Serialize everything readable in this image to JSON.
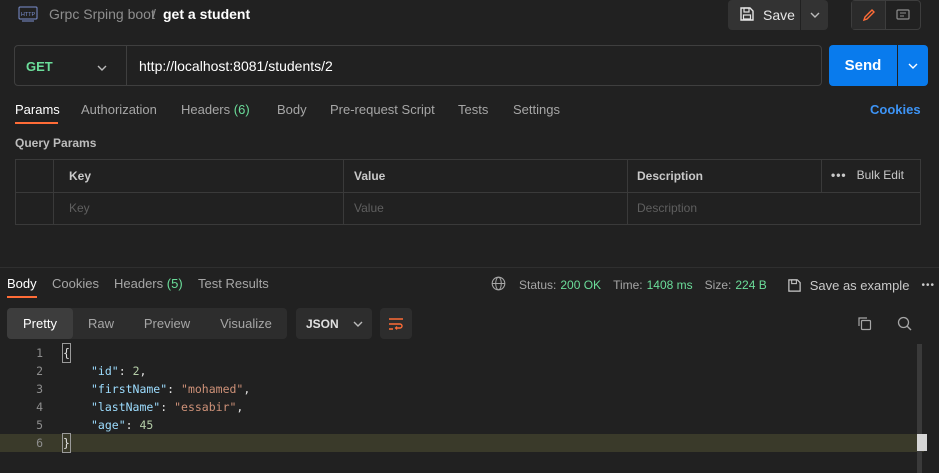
{
  "breadcrumb": {
    "parent": "Grpc Srping boot",
    "separator": "/",
    "current": "get a student"
  },
  "toolbar": {
    "save_label": "Save"
  },
  "request": {
    "method": "GET",
    "url": "http://localhost:8081/students/2",
    "send_label": "Send"
  },
  "request_tabs": [
    {
      "label": "Params"
    },
    {
      "label": "Authorization"
    },
    {
      "label": "Headers",
      "count": "(6)"
    },
    {
      "label": "Body"
    },
    {
      "label": "Pre-request Script"
    },
    {
      "label": "Tests"
    },
    {
      "label": "Settings"
    }
  ],
  "cookies_link": "Cookies",
  "query_params": {
    "title": "Query Params",
    "columns": [
      "Key",
      "Value",
      "Description"
    ],
    "placeholders": [
      "Key",
      "Value",
      "Description"
    ],
    "bulk_edit": "Bulk Edit"
  },
  "response_tabs": [
    {
      "label": "Body"
    },
    {
      "label": "Cookies"
    },
    {
      "label": "Headers",
      "count": "(5)"
    },
    {
      "label": "Test Results"
    }
  ],
  "status": {
    "status_label": "Status:",
    "status_value": "200 OK",
    "time_label": "Time:",
    "time_value": "1408 ms",
    "size_label": "Size:",
    "size_value": "224 B",
    "save_example": "Save as example"
  },
  "format_tabs": [
    "Pretty",
    "Raw",
    "Preview",
    "Visualize"
  ],
  "format_select": "JSON",
  "code_lines": [
    {
      "n": "1"
    },
    {
      "n": "2",
      "key": "\"id\"",
      "sep": ": ",
      "val": "2",
      "tail": ","
    },
    {
      "n": "3",
      "key": "\"firstName\"",
      "sep": ": ",
      "val": "\"mohamed\"",
      "tail": ","
    },
    {
      "n": "4",
      "key": "\"lastName\"",
      "sep": ": ",
      "val": "\"essabir\"",
      "tail": ","
    },
    {
      "n": "5",
      "key": "\"age\"",
      "sep": ": ",
      "val": "45",
      "tail": ""
    },
    {
      "n": "6"
    }
  ],
  "braces": {
    "open": "{",
    "close": "}"
  },
  "colors": {
    "accent": "#ff6c37",
    "send": "#097bed",
    "get": "#6bdd9a",
    "link": "#3d94f6"
  }
}
